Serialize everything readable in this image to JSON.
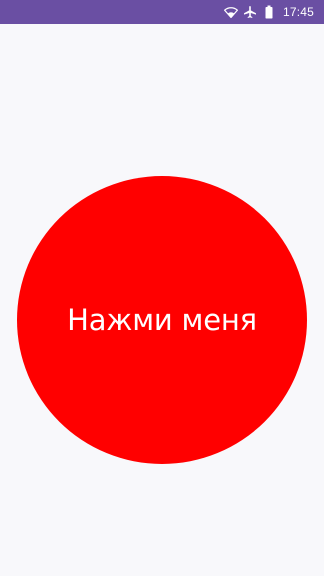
{
  "status_bar": {
    "time": "17:45",
    "icons": [
      "wifi-icon",
      "airplane-mode-icon",
      "battery-icon"
    ],
    "background_color": "#6a4fa3"
  },
  "main": {
    "button_label": "Нажми меня",
    "button_color": "#ff0000",
    "background_color": "#f8f8fb"
  }
}
